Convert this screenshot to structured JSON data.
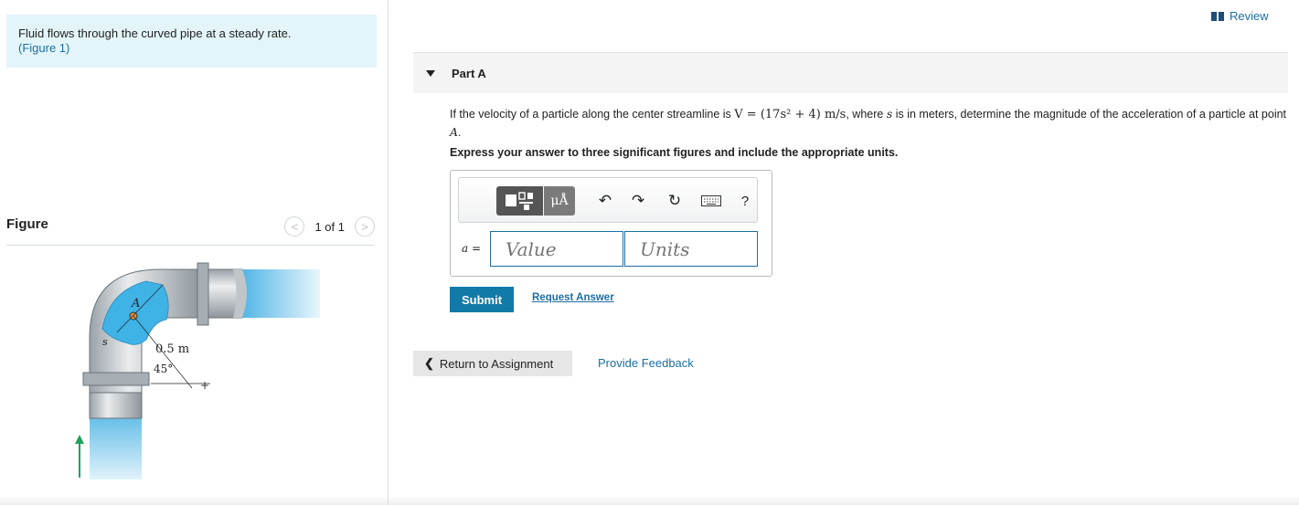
{
  "intro": {
    "text": "Fluid flows through the curved pipe at a steady rate.",
    "figure_link": "(Figure 1)"
  },
  "figure_panel": {
    "title": "Figure",
    "pager": "1 of 1",
    "labels": {
      "point_a": "A",
      "s": "s",
      "radius": "0.5 m",
      "angle": "45°"
    }
  },
  "header": {
    "review_label": "Review"
  },
  "part": {
    "title": "Part A",
    "question_pre": "If the velocity of a particle along the center streamline is ",
    "formula": "V = (17s² + 4) m/s",
    "question_mid": ", where ",
    "var_s": "s",
    "question_post": " is in meters, determine the magnitude of the acceleration of a particle at point ",
    "point": "A",
    "period": ".",
    "instruction": "Express your answer to three significant figures and include the appropriate units."
  },
  "answer": {
    "label": "a =",
    "value_placeholder": "Value",
    "units_placeholder": "Units",
    "toolbar": {
      "mu_label": "μÅ",
      "help_label": "?"
    }
  },
  "actions": {
    "submit_label": "Submit",
    "request_answer_label": "Request Answer",
    "return_label": "Return to Assignment",
    "feedback_label": "Provide Feedback"
  },
  "colors": {
    "link": "#1c6ea4",
    "submit_bg": "#127aa7",
    "intro_bg": "#e3f5f8",
    "fluid": "#3fb3e6"
  }
}
